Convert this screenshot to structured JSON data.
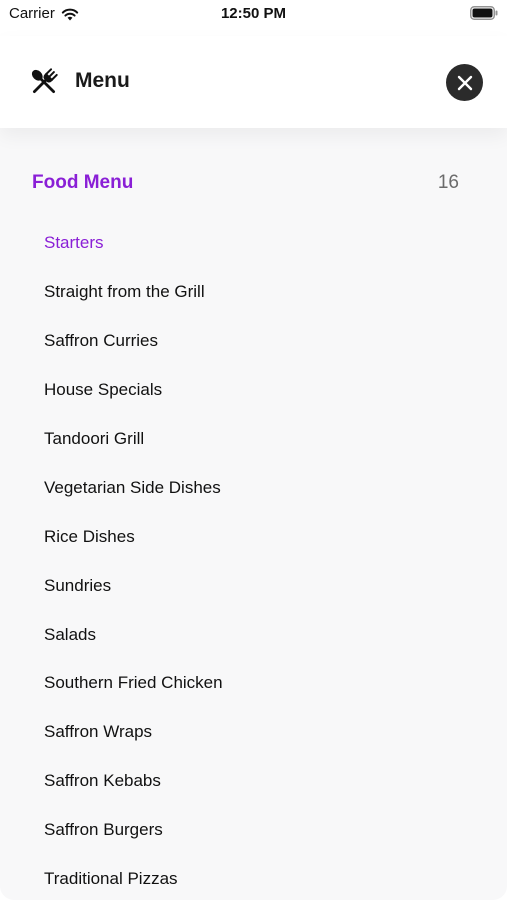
{
  "status_bar": {
    "carrier": "Carrier",
    "time": "12:50 PM"
  },
  "header": {
    "title": "Menu",
    "icon": "fork-and-spoon-icon",
    "close_icon": "close-icon"
  },
  "section": {
    "title": "Food Menu",
    "count": "16"
  },
  "items": [
    {
      "label": "Starters",
      "active": true
    },
    {
      "label": "Straight from the Grill"
    },
    {
      "label": "Saffron Curries"
    },
    {
      "label": "House Specials"
    },
    {
      "label": "Tandoori Grill"
    },
    {
      "label": "Vegetarian Side Dishes"
    },
    {
      "label": "Rice Dishes"
    },
    {
      "label": "Sundries"
    },
    {
      "label": "Salads"
    },
    {
      "label": "Southern Fried Chicken"
    },
    {
      "label": "Saffron Wraps"
    },
    {
      "label": "Saffron Kebabs"
    },
    {
      "label": "Saffron Burgers"
    },
    {
      "label": "Traditional Pizzas"
    }
  ],
  "colors": {
    "accent": "#8a1fd6",
    "close_button": "#2b2b2b",
    "panel_bg": "#f8f8f9",
    "count": "#6b6b6b"
  }
}
